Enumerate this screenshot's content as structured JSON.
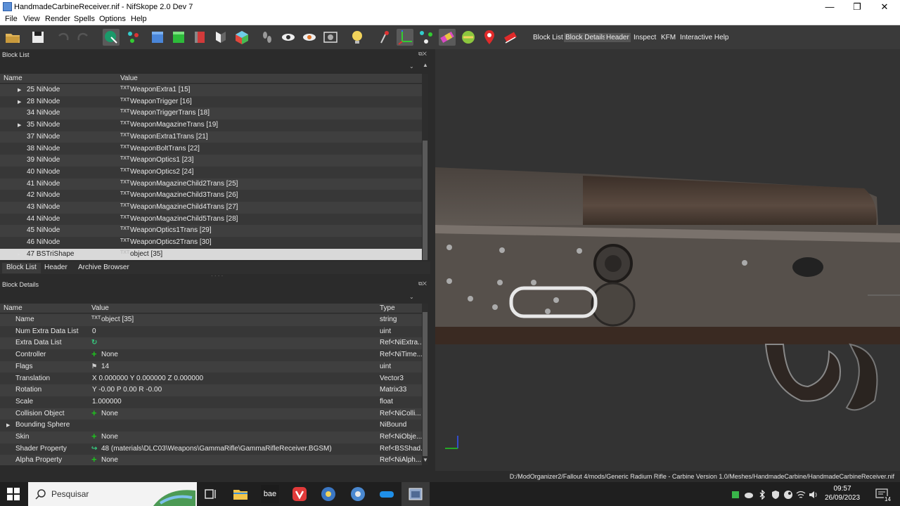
{
  "window": {
    "title": "HandmadeCarbineReceiver.nif - NifSkope 2.0 Dev 7",
    "minimize": "—",
    "maximize": "❐",
    "close": "✕"
  },
  "menu": [
    "File",
    "View",
    "Render",
    "Spells",
    "Options",
    "Help"
  ],
  "toolbar": {
    "tabs": [
      "Block List",
      "Block Details",
      "Header",
      "Inspect",
      "KFM",
      "Interactive Help"
    ]
  },
  "block_list": {
    "title": "Block List",
    "columns": [
      "Name",
      "Value"
    ],
    "rows": [
      {
        "expand": "▶",
        "name": "25 NiNode",
        "icon": "TXT",
        "value": "WeaponExtra1 [15]"
      },
      {
        "expand": "▶",
        "name": "28 NiNode",
        "icon": "TXT",
        "value": "WeaponTrigger [16]"
      },
      {
        "expand": "",
        "name": "34 NiNode",
        "icon": "TXT",
        "value": "WeaponTriggerTrans [18]"
      },
      {
        "expand": "▶",
        "name": "35 NiNode",
        "icon": "TXT",
        "value": "WeaponMagazineTrans [19]"
      },
      {
        "expand": "",
        "name": "37 NiNode",
        "icon": "TXT",
        "value": "WeaponExtra1Trans [21]"
      },
      {
        "expand": "",
        "name": "38 NiNode",
        "icon": "TXT",
        "value": "WeaponBoltTrans [22]"
      },
      {
        "expand": "",
        "name": "39 NiNode",
        "icon": "TXT",
        "value": "WeaponOptics1 [23]"
      },
      {
        "expand": "",
        "name": "40 NiNode",
        "icon": "TXT",
        "value": "WeaponOptics2 [24]"
      },
      {
        "expand": "",
        "name": "41 NiNode",
        "icon": "TXT",
        "value": "WeaponMagazineChild2Trans [25]"
      },
      {
        "expand": "",
        "name": "42 NiNode",
        "icon": "TXT",
        "value": "WeaponMagazineChild3Trans [26]"
      },
      {
        "expand": "",
        "name": "43 NiNode",
        "icon": "TXT",
        "value": "WeaponMagazineChild4Trans [27]"
      },
      {
        "expand": "",
        "name": "44 NiNode",
        "icon": "TXT",
        "value": "WeaponMagazineChild5Trans [28]"
      },
      {
        "expand": "",
        "name": "45 NiNode",
        "icon": "TXT",
        "value": "WeaponOptics1Trans [29]"
      },
      {
        "expand": "",
        "name": "46 NiNode",
        "icon": "TXT",
        "value": "WeaponOptics2Trans [30]"
      },
      {
        "expand": "▸",
        "name": "47 BSTriShape",
        "icon": "TXT",
        "value": "object [35]"
      }
    ]
  },
  "dock_tabs": [
    "Block List",
    "Header",
    "Archive Browser"
  ],
  "block_details": {
    "title": "Block Details",
    "columns": [
      "Name",
      "Value",
      "Type"
    ],
    "rows": [
      {
        "expand": "",
        "name": "Name",
        "icon": "TXT",
        "value": "object [35]",
        "type": "string"
      },
      {
        "expand": "",
        "name": "Num Extra Data List",
        "icon": "",
        "value": "0",
        "type": "uint"
      },
      {
        "expand": "",
        "name": "Extra Data List",
        "icon": "↻",
        "value": "",
        "type": "Ref<NiExtra..."
      },
      {
        "expand": "",
        "name": "Controller",
        "icon": "+",
        "value": "None",
        "type": "Ref<NiTime..."
      },
      {
        "expand": "",
        "name": "Flags",
        "icon": "⚑",
        "value": "14",
        "type": "uint"
      },
      {
        "expand": "",
        "name": "Translation",
        "icon": "",
        "value": "X 0.000000 Y 0.000000 Z 0.000000",
        "type": "Vector3"
      },
      {
        "expand": "",
        "name": "Rotation",
        "icon": "",
        "value": "Y -0.00 P 0.00 R -0.00",
        "type": "Matrix33"
      },
      {
        "expand": "",
        "name": "Scale",
        "icon": "",
        "value": "1.000000",
        "type": "float"
      },
      {
        "expand": "",
        "name": "Collision Object",
        "icon": "+",
        "value": "None",
        "type": "Ref<NiColli..."
      },
      {
        "expand": "▶",
        "name": "Bounding Sphere",
        "icon": "",
        "value": "",
        "type": "NiBound"
      },
      {
        "expand": "",
        "name": "Skin",
        "icon": "+",
        "value": "None",
        "type": "Ref<NiObje..."
      },
      {
        "expand": "",
        "name": "Shader Property",
        "icon": "↪",
        "value": "48 (materials\\DLC03\\Weapons\\GammaRifle\\GammaRifleReceiver.BGSM)",
        "type": "Ref<BSShad..."
      },
      {
        "expand": "",
        "name": "Alpha Property",
        "icon": "+",
        "value": "None",
        "type": "Ref<NiAlph..."
      }
    ]
  },
  "status": {
    "path": "D:/ModOrganizer2/Fallout 4/mods/Generic Radium Rifle - Carbine Version 1.0/Meshes/HandmadeCarbine/HandmadeCarbineReceiver.nif"
  },
  "taskbar": {
    "search_placeholder": "Pesquisar",
    "app_bae": "bae",
    "time": "09:57",
    "date": "26/09/2023",
    "notifications": "14"
  },
  "colors": {
    "accent_green": "#1ec21e",
    "selection": "#d9d9d9",
    "panel_bg": "#373737"
  }
}
